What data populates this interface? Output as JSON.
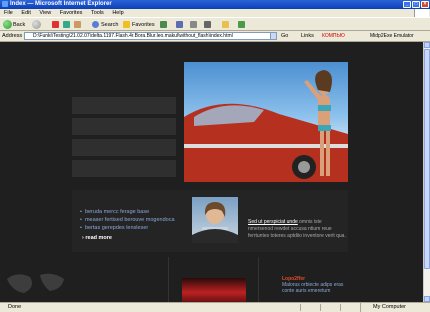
{
  "window": {
    "title": "Index — Microsoft Internet Explorer"
  },
  "menu": [
    "File",
    "Edit",
    "View",
    "Favorites",
    "Tools",
    "Help"
  ],
  "toolbar": {
    "back": "Back",
    "search": "Search",
    "favorites": "Favorites"
  },
  "address": {
    "label": "Address",
    "url": "D:\\Funki\\Testing\\21.02.07\\delta.1197.Flash.4r.Bora.Blur.leo.makul\\without_flash\\index.html",
    "go": "Go",
    "links": "Links",
    "ext1": "КОМПЬЮ",
    "ext2": "Midp2Exe Emulator"
  },
  "page": {
    "side_links": [
      "beruda mercc ferage base",
      "measer fertised berouve mogendoca",
      "bertas gerepdes lensleser"
    ],
    "read_more": "read more",
    "desc_lead": "Sed ut perspiciat unde",
    "desc_body": "omnis iste nmersenod rewdet accusa ntium reue ferrtuntes toteres aptdiio inventore verit qua.",
    "lower_title": "Lopo2ffer",
    "lower_lines": [
      "Malorus orbiecte adips eras",
      "conte auris emeretum"
    ]
  },
  "status": {
    "text": "Done",
    "zone": "My Computer"
  }
}
